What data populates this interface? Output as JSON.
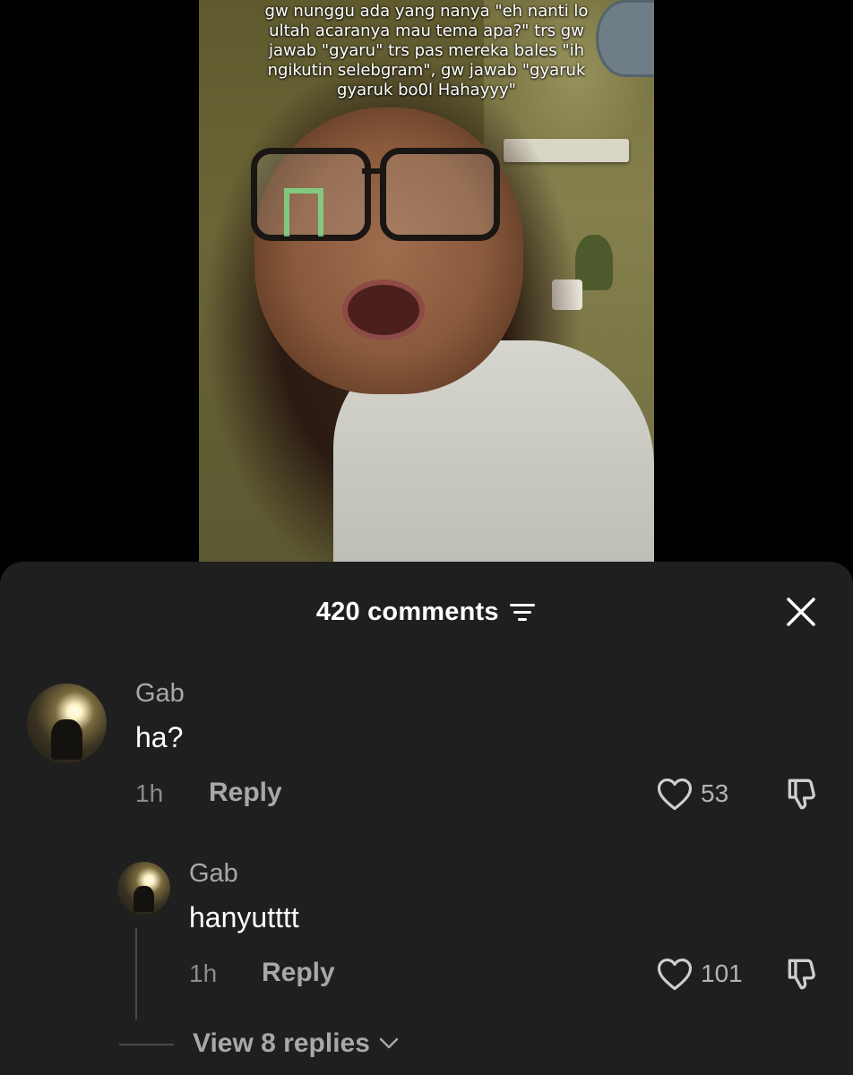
{
  "video": {
    "caption": "gw nunggu ada yang nanya \"eh nanti lo ultah acaranya mau tema apa?\" trs gw jawab \"gyaru\" trs pas mereka bales \"ih ngikutin selebgram\", gw jawab \"gyaruk gyaruk bo0l Hahayyy\""
  },
  "comments_panel": {
    "count_label": "420 comments",
    "filter_icon": "filter-icon",
    "close_icon": "close-icon",
    "comments": [
      {
        "username": "Gab",
        "text": "ha?",
        "time": "1h",
        "reply_label": "Reply",
        "likes": "53"
      },
      {
        "username": "Gab",
        "text": "hanyutttt",
        "time": "1h",
        "reply_label": "Reply",
        "likes": "101"
      }
    ],
    "view_replies_label": "View 8 replies"
  },
  "colors": {
    "sheet_bg": "#1f1f1f",
    "muted_text": "#a8a8a8",
    "primary_text": "#ffffff"
  }
}
